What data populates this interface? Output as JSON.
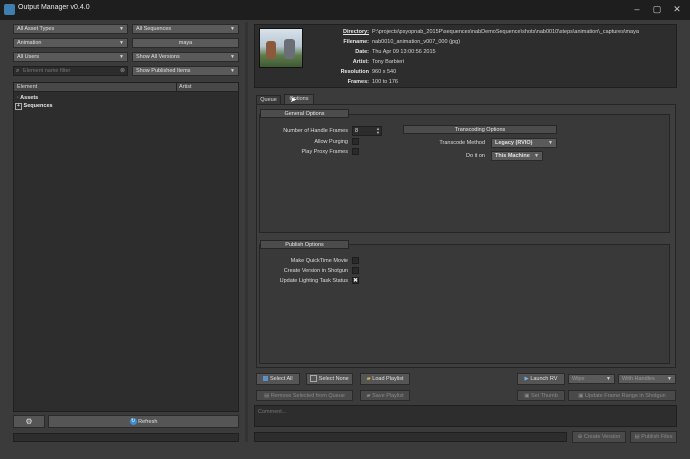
{
  "window": {
    "title": "Output Manager v0.4.0",
    "minimize": "–",
    "maximize": "▢",
    "close": "✕"
  },
  "filters": {
    "asset_types": "All Asset Types",
    "sequences": "All Sequences",
    "animation": "Animation",
    "maya": "maya",
    "users": "All Users",
    "versions": "Show All Versions",
    "element_filter_placeholder": "Element name filter",
    "published": "Show Published Items"
  },
  "tree": {
    "col_element": "Element",
    "col_artist": "Artist",
    "items": [
      {
        "label": "Assets",
        "expander": "·"
      },
      {
        "label": "Sequences",
        "expander": "+"
      }
    ]
  },
  "left_bottom": {
    "refresh": "Refresh"
  },
  "info": {
    "directory_label": "Directory:",
    "directory": "P:\\projects\\psyopnab_2015P\\sequences\\nabDemoSequence\\shots\\nab0010\\steps\\animation\\_captures\\maya",
    "filename_label": "Filename:",
    "filename": "nab0010_animation_v007_000  (jpg)",
    "date_label": "Date:",
    "date": "Thu Apr 09 13:00:56 2015",
    "artist_label": "Artist:",
    "artist": "Tony Barbieri",
    "resolution_label": "Resolution",
    "resolution": "960 x 540",
    "frames_label": "Frames:",
    "frames": "100 to 176"
  },
  "tabs": {
    "queue": "Queue",
    "options": "Options"
  },
  "general": {
    "title": "General Options",
    "handle_label": "Number of Handle Frames",
    "handle_value": "8",
    "allow_purging": "Allow Purging",
    "proxy_frames": "Play Proxy Frames",
    "transcoding_title": "Transcoding Options",
    "transcode_label": "Transcode Method",
    "transcode_value": "Legacy (RVIO)",
    "doit_label": "Do it on",
    "doit_value": "This Machine"
  },
  "publish": {
    "title": "Publish Options",
    "quicktime": "Make QuickTime Movie",
    "shotgun": "Create Version in Shotgun",
    "lighting": "Update Lighting Task Status",
    "lighting_check": "✖"
  },
  "actions": {
    "select_all": "Select All",
    "select_none": "Select None",
    "load_playlist": "Load Playlist",
    "launch_rv": "Launch RV",
    "wipe": "Wipe",
    "with_handles": "With Handles",
    "remove_selected": "Remove Selected from Queue",
    "save_playlist": "Save Playlist",
    "set_thumb": "Set Thumb",
    "update_range": "Update Frame Range in Shotgun",
    "comment_placeholder": "Comment...",
    "create_version": "Create Version",
    "publish_files": "Publish Files"
  },
  "colors": {
    "bg": "#3b3b3b",
    "panel": "#2d2d2d",
    "titlebar": "#1e1e1e"
  }
}
